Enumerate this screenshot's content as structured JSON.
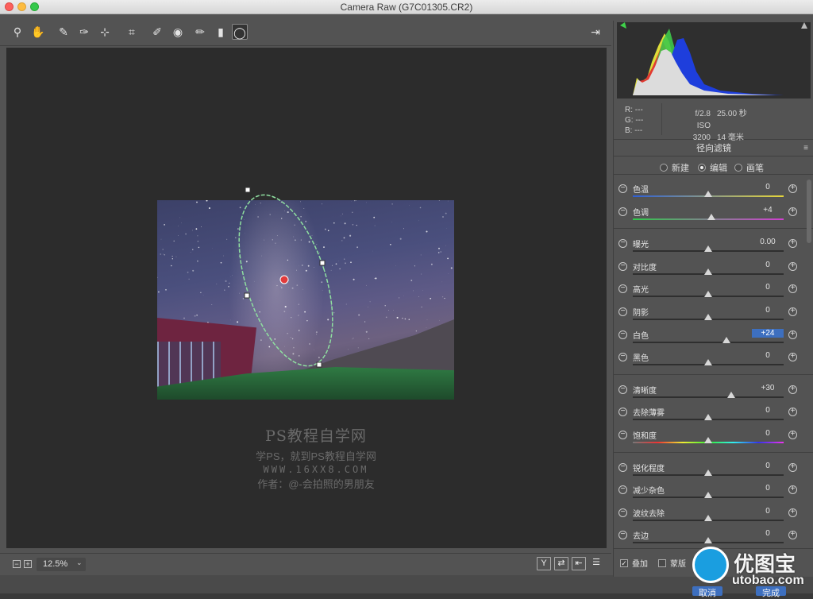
{
  "window": {
    "title": "Camera Raw (G7C01305.CR2)"
  },
  "toolbar": {
    "tools": [
      {
        "name": "zoom-tool",
        "glyph": "⚲"
      },
      {
        "name": "hand-tool",
        "glyph": "✋"
      },
      {
        "name": "white-balance-tool",
        "glyph": "✎"
      },
      {
        "name": "color-sampler-tool",
        "glyph": "✑"
      },
      {
        "name": "targeted-adjust-tool",
        "glyph": "⊹"
      },
      {
        "name": "crop-tool",
        "glyph": "⌗"
      },
      {
        "name": "spot-removal-tool",
        "glyph": "✐"
      },
      {
        "name": "red-eye-tool",
        "glyph": "◉"
      },
      {
        "name": "adjustment-brush-tool",
        "glyph": "✏"
      },
      {
        "name": "graduated-filter-tool",
        "glyph": "▮"
      },
      {
        "name": "radial-filter-tool",
        "glyph": "◯"
      }
    ],
    "export_glyph": "⇥"
  },
  "watermark": {
    "line1": "PS教程自学网",
    "line2": "学PS，就到PS教程自学网",
    "line3": "WWW.16XX8.COM",
    "line4": "作者：@-会拍照的男朋友"
  },
  "bottom": {
    "zoom_out": "−",
    "zoom_in": "+",
    "zoom_value": "12.5%",
    "zoom_caret": "⌄",
    "view_buttons": [
      "Y",
      "⇄",
      "⇤",
      "☰"
    ]
  },
  "readout": {
    "r": "R:  ---",
    "g": "G:  ---",
    "b": "B:  ---",
    "aperture": "f/2.8",
    "shutter": "25.00 秒",
    "iso": "ISO 3200",
    "focal": "14 毫米"
  },
  "panel": {
    "title": "径向滤镜",
    "menu_glyph": "≡",
    "modes": [
      {
        "label": "新建",
        "selected": false
      },
      {
        "label": "编辑",
        "selected": true
      },
      {
        "label": "画笔",
        "selected": false
      }
    ],
    "sliders": [
      {
        "label": "色温",
        "value": "0",
        "pos": 0.5,
        "track": "temp"
      },
      {
        "label": "色调",
        "value": "+4",
        "pos": 0.52,
        "track": "tint"
      },
      {
        "label": "曝光",
        "value": "0.00",
        "pos": 0.5,
        "track": "plain"
      },
      {
        "label": "对比度",
        "value": "0",
        "pos": 0.5,
        "track": "plain"
      },
      {
        "label": "高光",
        "value": "0",
        "pos": 0.5,
        "track": "plain"
      },
      {
        "label": "阴影",
        "value": "0",
        "pos": 0.5,
        "track": "plain"
      },
      {
        "label": "白色",
        "value": "+24",
        "pos": 0.62,
        "track": "plain",
        "selected": true
      },
      {
        "label": "黑色",
        "value": "0",
        "pos": 0.5,
        "track": "plain"
      },
      {
        "label": "清晰度",
        "value": "+30",
        "pos": 0.65,
        "track": "plain"
      },
      {
        "label": "去除薄雾",
        "value": "0",
        "pos": 0.5,
        "track": "plain"
      },
      {
        "label": "饱和度",
        "value": "0",
        "pos": 0.5,
        "track": "sat"
      },
      {
        "label": "锐化程度",
        "value": "0",
        "pos": 0.5,
        "track": "plain"
      },
      {
        "label": "减少杂色",
        "value": "0",
        "pos": 0.5,
        "track": "plain"
      },
      {
        "label": "波纹去除",
        "value": "0",
        "pos": 0.5,
        "track": "plain"
      },
      {
        "label": "去边",
        "value": "0",
        "pos": 0.5,
        "track": "plain"
      }
    ],
    "overlay_label": "叠加",
    "overlay_checked": true,
    "mask_label": "蒙版",
    "mask_checked": false
  },
  "buttons": {
    "cancel": "取消",
    "done": "完成"
  },
  "logo": {
    "cn": "优图宝",
    "url": "utobao.com"
  }
}
